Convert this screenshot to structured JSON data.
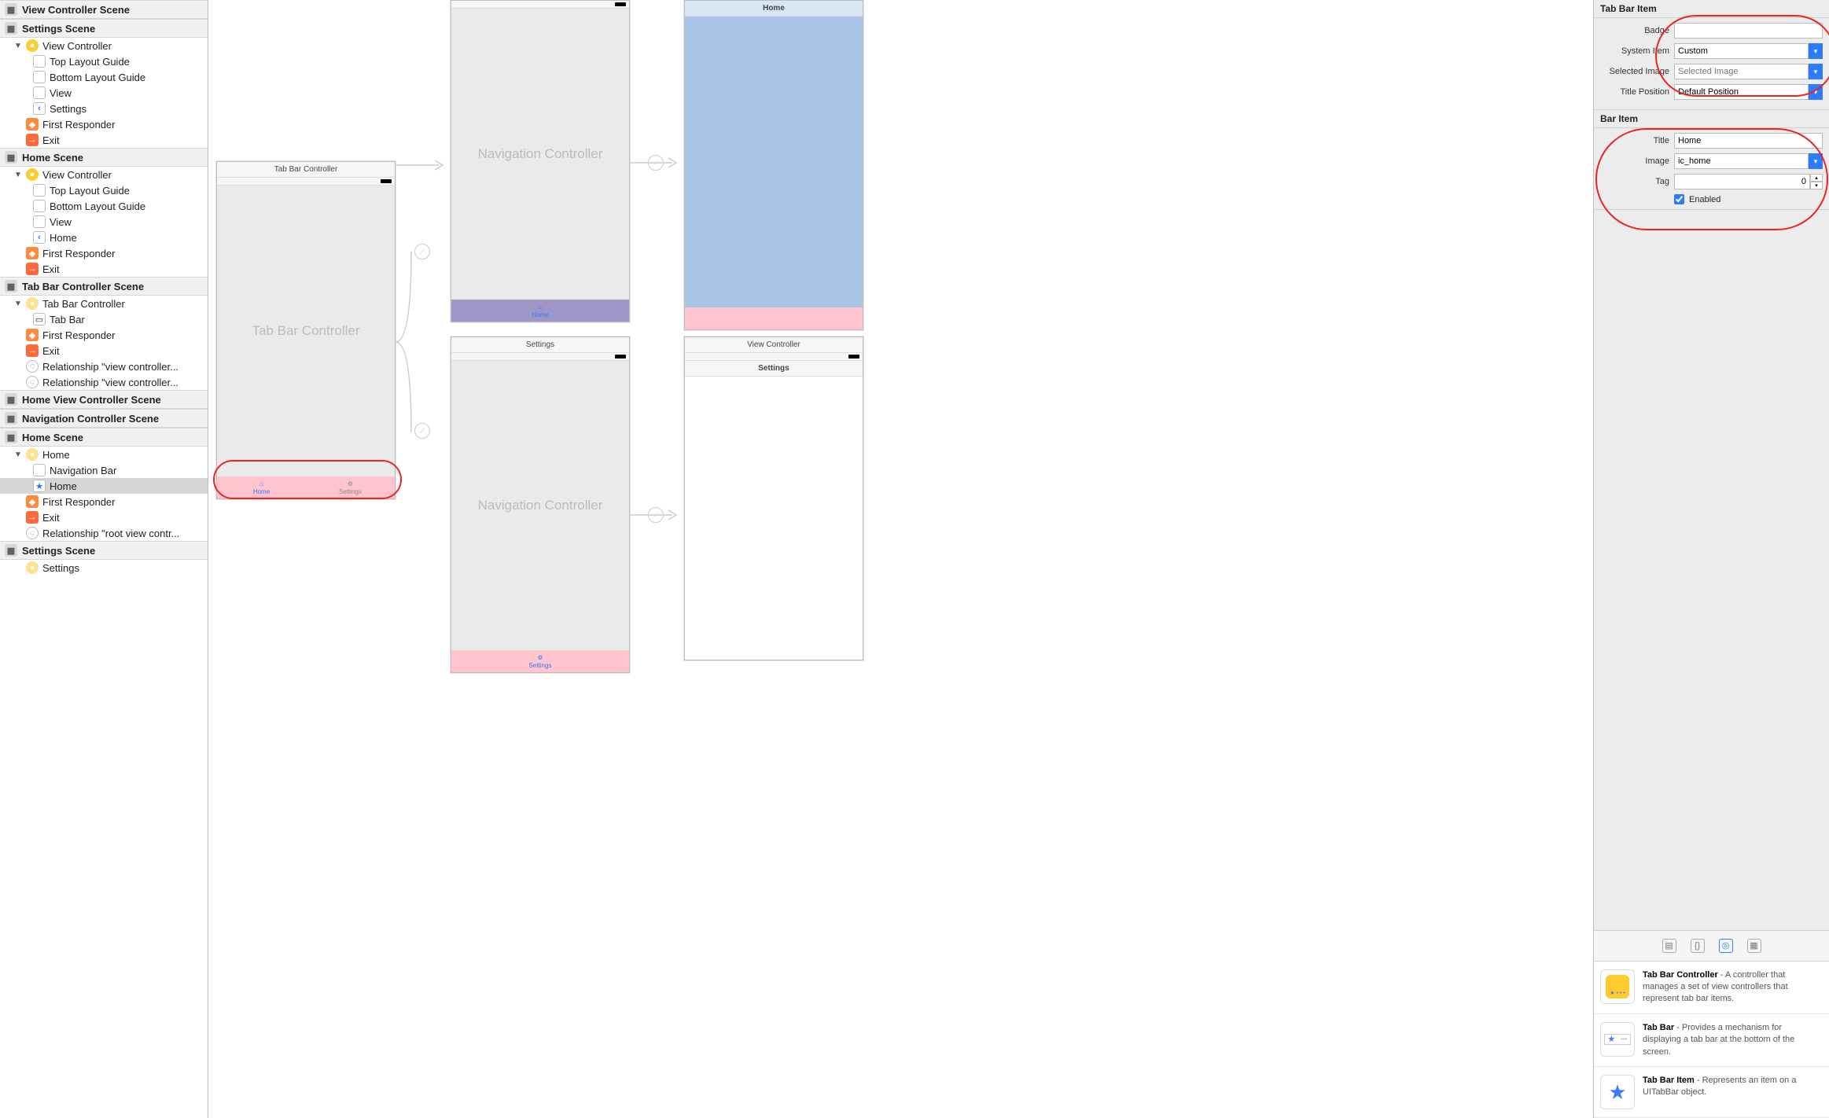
{
  "outline": {
    "scenes": [
      {
        "title": "View Controller Scene"
      },
      {
        "title": "Settings Scene",
        "items": [
          {
            "t": "vc",
            "label": "View Controller",
            "open": true,
            "children": [
              {
                "t": "box",
                "label": "Top Layout Guide"
              },
              {
                "t": "box",
                "label": "Bottom Layout Guide"
              },
              {
                "t": "box",
                "label": "View"
              },
              {
                "t": "back",
                "label": "Settings"
              }
            ]
          },
          {
            "t": "cube",
            "label": "First Responder"
          },
          {
            "t": "exit",
            "label": "Exit"
          }
        ]
      },
      {
        "title": "Home Scene",
        "items": [
          {
            "t": "vc",
            "label": "View Controller",
            "open": true,
            "children": [
              {
                "t": "box",
                "label": "Top Layout Guide"
              },
              {
                "t": "box",
                "label": "Bottom Layout Guide"
              },
              {
                "t": "box",
                "label": "View"
              },
              {
                "t": "back",
                "label": "Home"
              }
            ]
          },
          {
            "t": "cube",
            "label": "First Responder"
          },
          {
            "t": "exit",
            "label": "Exit"
          }
        ]
      },
      {
        "title": "Tab Bar Controller Scene",
        "items": [
          {
            "t": "vc-w",
            "label": "Tab Bar Controller",
            "open": true,
            "children": [
              {
                "t": "tabbar",
                "label": "Tab Bar"
              }
            ]
          },
          {
            "t": "cube",
            "label": "First Responder"
          },
          {
            "t": "exit",
            "label": "Exit"
          },
          {
            "t": "rel",
            "label": "Relationship \"view controller..."
          },
          {
            "t": "rel",
            "label": "Relationship \"view controller..."
          }
        ]
      },
      {
        "title": "Home View Controller Scene"
      },
      {
        "title": "Navigation Controller Scene"
      },
      {
        "title": "Home Scene",
        "items": [
          {
            "t": "vc-w",
            "label": "Home",
            "open": true,
            "children": [
              {
                "t": "box",
                "label": "Navigation Bar"
              },
              {
                "t": "star",
                "label": "Home",
                "selected": true
              }
            ]
          },
          {
            "t": "cube",
            "label": "First Responder"
          },
          {
            "t": "exit",
            "label": "Exit"
          },
          {
            "t": "rel",
            "label": "Relationship \"root view contr..."
          }
        ]
      },
      {
        "title": "Settings Scene",
        "items": [
          {
            "t": "vc-w",
            "label": "Settings",
            "open": true
          }
        ]
      }
    ]
  },
  "canvas": {
    "tabbar_controller": {
      "title": "Tab Bar Controller",
      "tabs": [
        "Home",
        "Settings"
      ]
    },
    "nav1": {
      "title": "Navigation Controller",
      "bottom_label": "Home"
    },
    "nav2": {
      "title": "Navigation Controller",
      "nav_title": "Settings",
      "bottom_label": "Settings"
    },
    "home_vc": {
      "nav_title": "Home"
    },
    "settings_vc": {
      "top_label": "View Controller",
      "nav_title": "Settings"
    }
  },
  "inspector": {
    "tabBarItem": {
      "section_title": "Tab Bar Item",
      "badge_label": "Badge",
      "badge_value": "",
      "system_item_label": "System Item",
      "system_item_value": "Custom",
      "selected_image_label": "Selected Image",
      "selected_image_placeholder": "Selected Image",
      "title_position_label": "Title Position",
      "title_position_value": "Default Position"
    },
    "barItem": {
      "section_title": "Bar Item",
      "title_label": "Title",
      "title_value": "Home",
      "image_label": "Image",
      "image_value": "ic_home",
      "tag_label": "Tag",
      "tag_value": "0",
      "enabled_label": "Enabled",
      "enabled_checked": true
    },
    "library": [
      {
        "title": "Tab Bar Controller",
        "desc": " - A controller that manages a set of view controllers that represent tab bar items.",
        "icon": "tbc"
      },
      {
        "title": "Tab Bar",
        "desc": " - Provides a mechanism for displaying a tab bar at the bottom of the screen.",
        "icon": "tb"
      },
      {
        "title": "Tab Bar Item",
        "desc": " - Represents an item on a UITabBar object.",
        "icon": "tbi"
      }
    ]
  }
}
